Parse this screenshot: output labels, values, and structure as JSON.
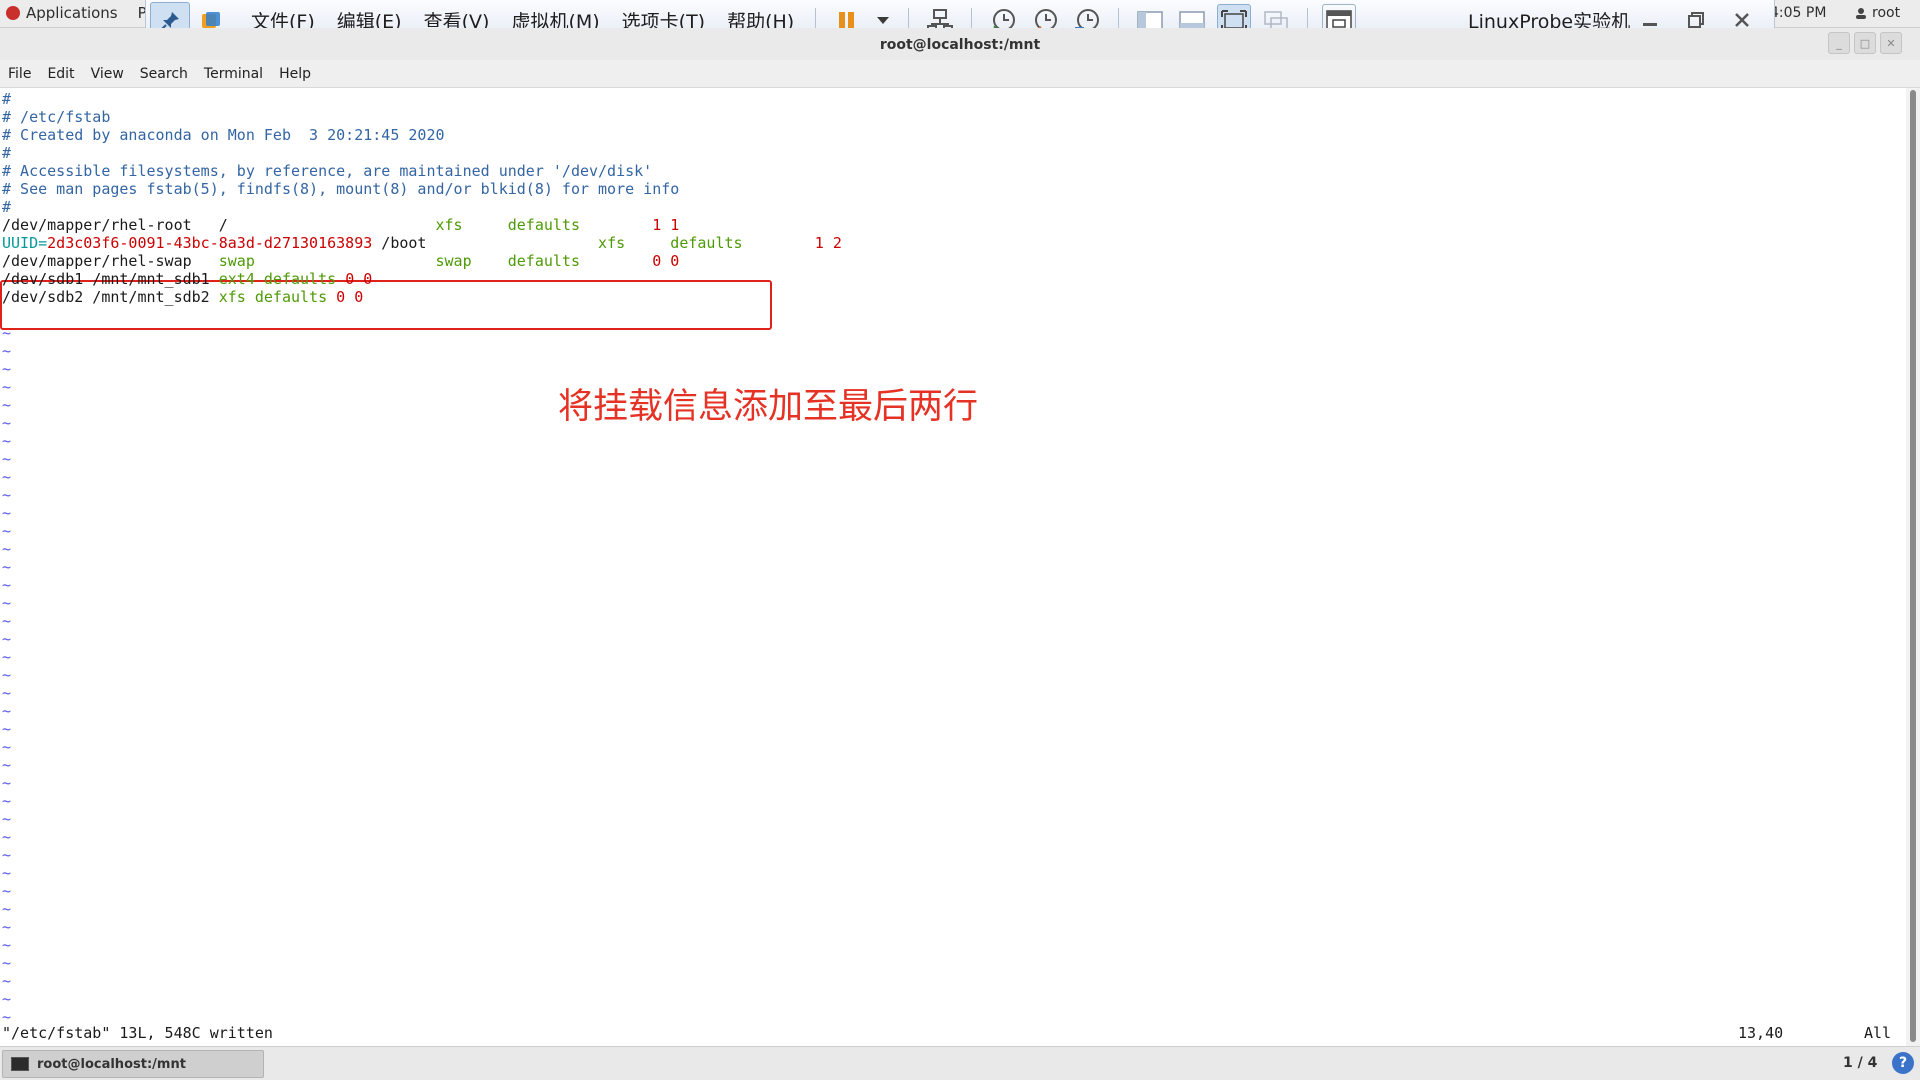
{
  "gnome": {
    "applications": "Applications",
    "places": "Pl",
    "clock": "4:05 PM",
    "user": "root"
  },
  "vmware": {
    "menu": [
      "文件(F)",
      "编辑(E)",
      "查看(V)",
      "虚拟机(M)",
      "选项卡(T)",
      "帮助(H)"
    ],
    "title": "LinuxProbe实验机"
  },
  "terminal": {
    "title": "root@localhost:/mnt",
    "menu": [
      "File",
      "Edit",
      "View",
      "Search",
      "Terminal",
      "Help"
    ]
  },
  "fstab": {
    "lines": [
      [
        {
          "t": "#",
          "c": "comment"
        }
      ],
      [
        {
          "t": "# /etc/fstab",
          "c": "comment"
        }
      ],
      [
        {
          "t": "# Created by anaconda on Mon Feb  3 20:21:45 2020",
          "c": "comment"
        }
      ],
      [
        {
          "t": "#",
          "c": "comment"
        }
      ],
      [
        {
          "t": "# Accessible filesystems, by reference, are maintained under '/dev/disk'",
          "c": "comment"
        }
      ],
      [
        {
          "t": "# See man pages fstab(5), findfs(8), mount(8) and/or blkid(8) for more info",
          "c": "comment"
        }
      ],
      [
        {
          "t": "#",
          "c": "comment"
        }
      ],
      [
        {
          "t": "/dev/mapper/rhel-root   /                       ",
          "c": "black"
        },
        {
          "t": "xfs     defaults        ",
          "c": "green"
        },
        {
          "t": "1 1",
          "c": "red"
        }
      ],
      [
        {
          "t": "UUID=",
          "c": "teal"
        },
        {
          "t": "2d3c03f6-0091-43bc-8a3d-d27130163893",
          "c": "red"
        },
        {
          "t": " /boot                   ",
          "c": "black"
        },
        {
          "t": "xfs     defaults        ",
          "c": "green"
        },
        {
          "t": "1 2",
          "c": "red"
        }
      ],
      [
        {
          "t": "/dev/mapper/rhel-swap   ",
          "c": "black"
        },
        {
          "t": "swap                    swap    defaults        ",
          "c": "green"
        },
        {
          "t": "0 0",
          "c": "red"
        }
      ],
      [
        {
          "t": "/dev/sdb1 /mnt/mnt_sdb1 ",
          "c": "black"
        },
        {
          "t": "ext4 defaults ",
          "c": "green"
        },
        {
          "t": "0 0",
          "c": "red"
        }
      ],
      [
        {
          "t": "/dev/sdb2 /mnt/mnt_sdb2 ",
          "c": "black"
        },
        {
          "t": "xfs defaults ",
          "c": "green"
        },
        {
          "t": "0 0",
          "c": "red"
        }
      ]
    ],
    "tilde": "~"
  },
  "annotation": "将挂载信息添加至最后两行",
  "status": {
    "message": "\"/etc/fstab\" 13L, 548C written",
    "position": "13,40",
    "scroll": "All"
  },
  "taskbar": {
    "item": "root@localhost:/mnt",
    "workspace": "1 / 4",
    "help": "?"
  },
  "colors": {
    "comment": "#3465a4",
    "green": "#4e9a06",
    "red": "#cc0000",
    "teal": "#06989a",
    "annotation": "#e53224"
  }
}
